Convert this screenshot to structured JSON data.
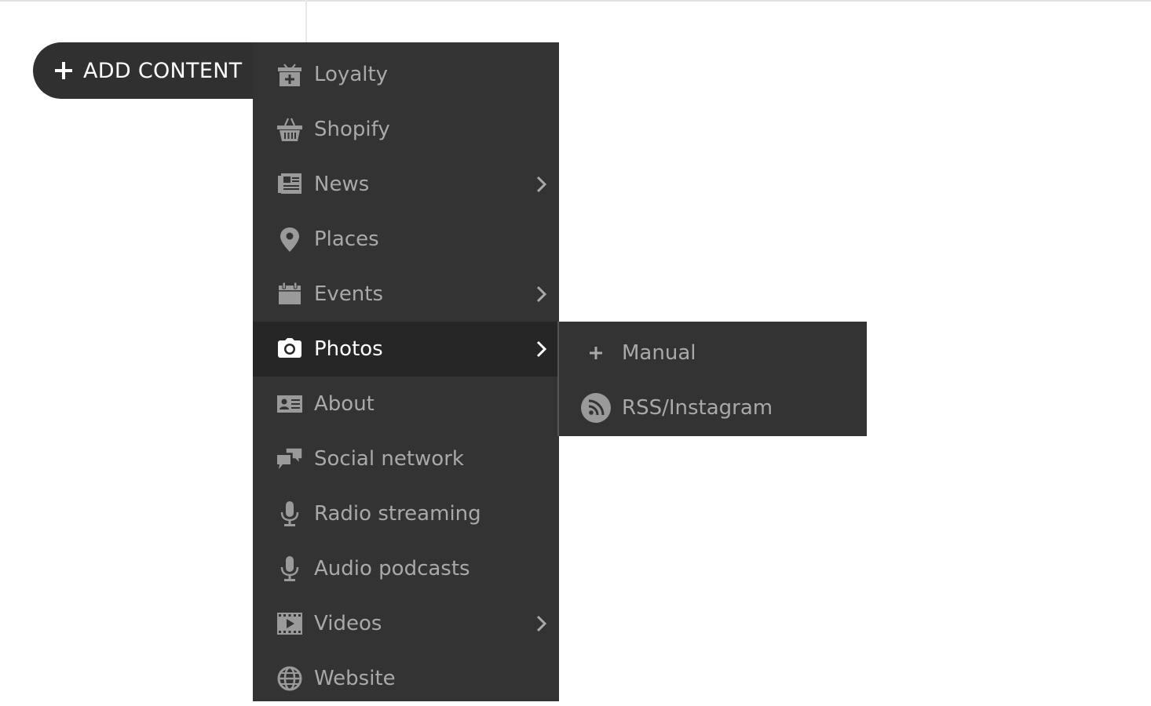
{
  "add_button": {
    "label": "ADD CONTENT",
    "icon": "plus-icon"
  },
  "menu": {
    "items": [
      {
        "label": "Loyalty",
        "icon": "gift-icon",
        "has_submenu": false
      },
      {
        "label": "Shopify",
        "icon": "basket-icon",
        "has_submenu": false
      },
      {
        "label": "News",
        "icon": "newspaper-icon",
        "has_submenu": true
      },
      {
        "label": "Places",
        "icon": "map-pin-icon",
        "has_submenu": false
      },
      {
        "label": "Events",
        "icon": "calendar-icon",
        "has_submenu": true
      },
      {
        "label": "Photos",
        "icon": "camera-icon",
        "has_submenu": true,
        "active": true
      },
      {
        "label": "About",
        "icon": "id-card-icon",
        "has_submenu": false
      },
      {
        "label": "Social network",
        "icon": "chat-bubbles-icon",
        "has_submenu": false
      },
      {
        "label": "Radio streaming",
        "icon": "microphone-icon",
        "has_submenu": false
      },
      {
        "label": "Audio podcasts",
        "icon": "microphone-icon",
        "has_submenu": false
      },
      {
        "label": "Videos",
        "icon": "film-icon",
        "has_submenu": true
      },
      {
        "label": "Website",
        "icon": "globe-icon",
        "has_submenu": false
      }
    ]
  },
  "submenu": {
    "parent": "Photos",
    "items": [
      {
        "label": "Manual",
        "icon": "plus-icon"
      },
      {
        "label": "RSS/Instagram",
        "icon": "rss-icon"
      }
    ]
  },
  "colors": {
    "menu_bg": "#333333",
    "active_bg": "#262626",
    "text_muted": "#a9a9a9",
    "text_active": "#ffffff"
  }
}
